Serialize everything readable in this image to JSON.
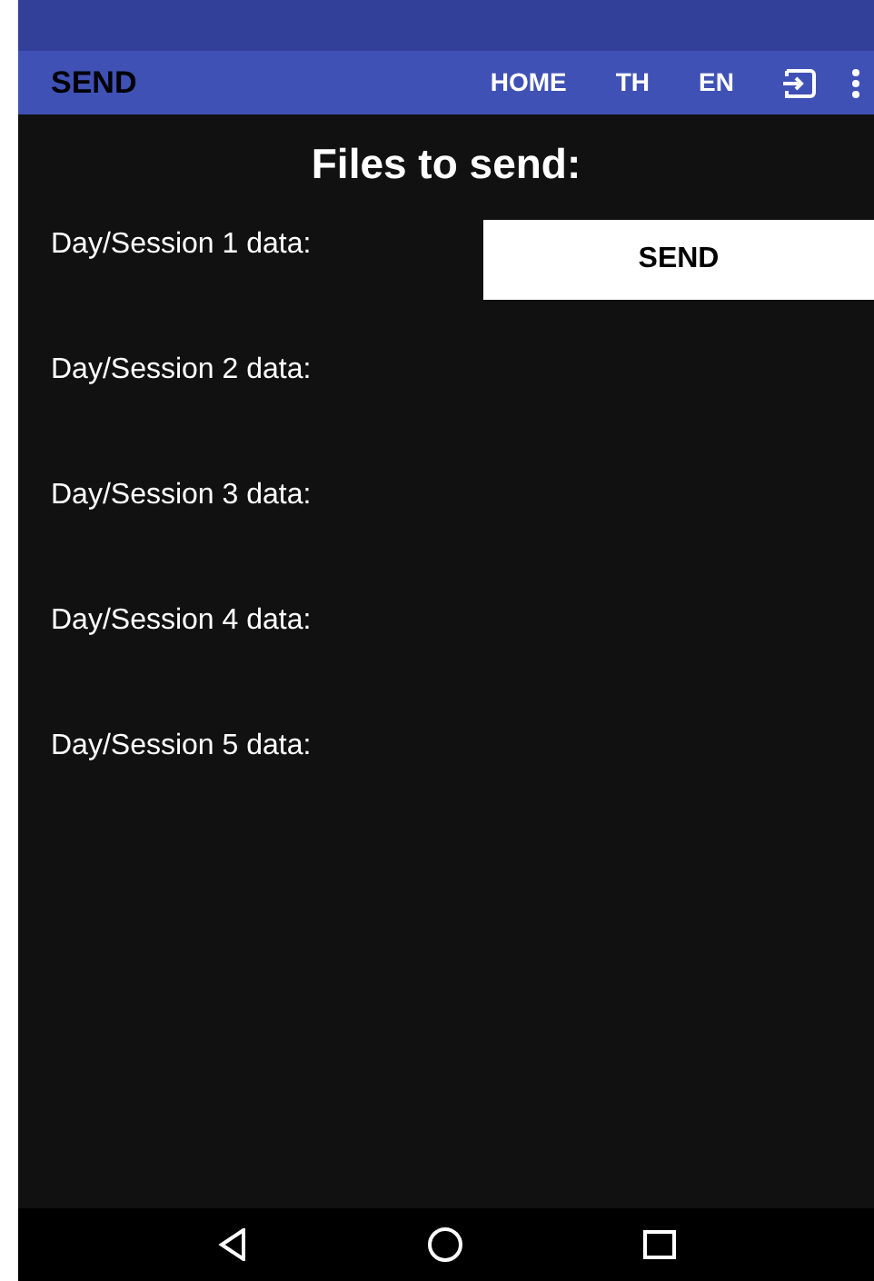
{
  "app_bar": {
    "title": "SEND",
    "actions": [
      "HOME",
      "TH",
      "EN"
    ]
  },
  "heading": "Files to send:",
  "files": [
    {
      "label": "Day/Session 1 data:",
      "button": "SEND"
    },
    {
      "label": "Day/Session 2 data:"
    },
    {
      "label": "Day/Session 3 data:"
    },
    {
      "label": "Day/Session 4 data:"
    },
    {
      "label": "Day/Session 5 data:"
    }
  ]
}
